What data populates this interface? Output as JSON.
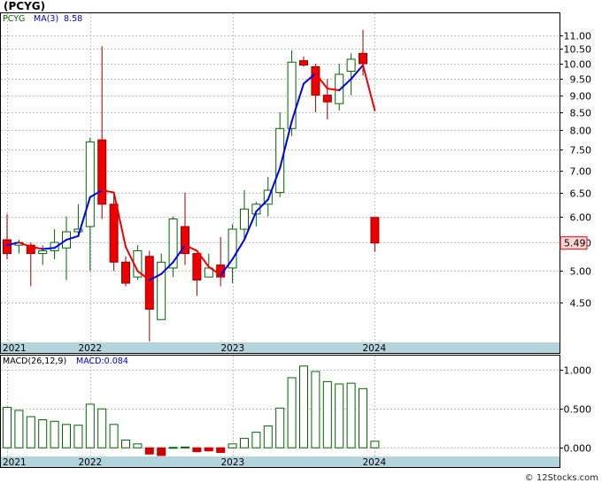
{
  "title": "(PCYG)",
  "watermark": "© 12Stocks.com",
  "price_panel": {
    "legend_symbol": "PCYG",
    "legend_ma_label": "MA(3)",
    "legend_ma_value": "8.58",
    "current_price_label": "5.49"
  },
  "macd_panel": {
    "legend_label": "MACD(26,12,9)",
    "legend_value_label": "MACD:0.084"
  },
  "colors": {
    "up_candle_fill": "#ffffff",
    "up_candle_border": "#006400",
    "down_candle_fill": "#ee0000",
    "down_candle_border": "#990000",
    "ma_up": "#0000ee",
    "ma_down": "#ee0000",
    "macd_pos": "#006400",
    "macd_neg": "#cc0000",
    "date_band": "#b3d4dc",
    "grid": "#c0c0c0"
  },
  "chart_data": [
    {
      "type": "candlestick",
      "scale": "log",
      "period": "monthly",
      "ylim": [
        3.95,
        11.8
      ],
      "y_ticks": [
        4.5,
        5.0,
        5.5,
        6.0,
        6.5,
        7.0,
        7.5,
        8.0,
        8.5,
        9.0,
        9.5,
        10.0,
        10.5,
        11.0
      ],
      "y_tick_labels": [
        "4.50",
        "5.00",
        "5.50",
        "6.00",
        "6.50",
        "7.00",
        "7.50",
        "8.00",
        "8.50",
        "9.00",
        "9.50",
        "10.00",
        "10.50",
        "11.00"
      ],
      "x_year_labels": [
        {
          "label": "2021",
          "index": 0
        },
        {
          "label": "2022",
          "index": 7
        },
        {
          "label": "2023",
          "index": 19
        },
        {
          "label": "2024",
          "index": 31
        }
      ],
      "candles": [
        {
          "open": 5.55,
          "high": 6.05,
          "low": 5.2,
          "close": 5.3
        },
        {
          "open": 5.45,
          "high": 5.55,
          "low": 5.3,
          "close": 5.5
        },
        {
          "open": 5.45,
          "high": 5.5,
          "low": 4.75,
          "close": 5.3
        },
        {
          "open": 5.3,
          "high": 5.45,
          "low": 5.1,
          "close": 5.35
        },
        {
          "open": 5.35,
          "high": 5.75,
          "low": 5.2,
          "close": 5.5
        },
        {
          "open": 5.4,
          "high": 6.0,
          "low": 4.85,
          "close": 5.7
        },
        {
          "open": 5.7,
          "high": 6.25,
          "low": 5.6,
          "close": 5.75
        },
        {
          "open": 5.8,
          "high": 7.8,
          "low": 5.0,
          "close": 7.7
        },
        {
          "open": 7.75,
          "high": 10.6,
          "low": 5.95,
          "close": 6.25
        },
        {
          "open": 6.25,
          "high": 6.45,
          "low": 5.0,
          "close": 5.15
        },
        {
          "open": 5.15,
          "high": 5.25,
          "low": 4.75,
          "close": 4.8
        },
        {
          "open": 4.9,
          "high": 5.45,
          "low": 4.85,
          "close": 5.35
        },
        {
          "open": 5.25,
          "high": 5.35,
          "low": 3.95,
          "close": 4.4
        },
        {
          "open": 4.25,
          "high": 5.3,
          "low": 4.25,
          "close": 5.15
        },
        {
          "open": 5.05,
          "high": 6.0,
          "low": 4.9,
          "close": 5.95
        },
        {
          "open": 5.8,
          "high": 6.5,
          "low": 5.1,
          "close": 5.3
        },
        {
          "open": 5.3,
          "high": 5.3,
          "low": 4.6,
          "close": 4.85
        },
        {
          "open": 4.9,
          "high": 5.3,
          "low": 4.9,
          "close": 5.05
        },
        {
          "open": 5.1,
          "high": 5.6,
          "low": 4.75,
          "close": 4.9
        },
        {
          "open": 5.05,
          "high": 5.85,
          "low": 4.8,
          "close": 5.75
        },
        {
          "open": 5.75,
          "high": 6.55,
          "low": 5.55,
          "close": 6.15
        },
        {
          "open": 6.05,
          "high": 6.3,
          "low": 5.8,
          "close": 6.25
        },
        {
          "open": 6.25,
          "high": 6.85,
          "low": 6.0,
          "close": 6.55
        },
        {
          "open": 6.5,
          "high": 8.5,
          "low": 6.4,
          "close": 8.05
        },
        {
          "open": 8.05,
          "high": 10.45,
          "low": 7.85,
          "close": 10.05
        },
        {
          "open": 10.1,
          "high": 10.25,
          "low": 9.9,
          "close": 9.95
        },
        {
          "open": 9.9,
          "high": 10.0,
          "low": 8.5,
          "close": 9.0
        },
        {
          "open": 9.0,
          "high": 9.5,
          "low": 8.3,
          "close": 8.8
        },
        {
          "open": 8.75,
          "high": 10.0,
          "low": 8.55,
          "close": 9.65
        },
        {
          "open": 9.75,
          "high": 10.35,
          "low": 9.0,
          "close": 10.15
        },
        {
          "open": 10.35,
          "high": 11.2,
          "low": 9.6,
          "close": 10.0
        },
        {
          "open": 5.98,
          "high": 5.98,
          "low": 5.33,
          "close": 5.49
        }
      ],
      "ma3": [
        5.45,
        5.5,
        5.42,
        5.38,
        5.4,
        5.55,
        5.62,
        6.4,
        6.55,
        6.5,
        5.42,
        5.0,
        4.85,
        4.95,
        5.15,
        5.45,
        5.35,
        5.07,
        4.93,
        5.2,
        5.55,
        6.1,
        6.35,
        7.05,
        8.25,
        9.35,
        9.68,
        9.2,
        9.15,
        9.5,
        9.95,
        8.55
      ]
    },
    {
      "type": "bar",
      "name": "MACD(26,12,9)",
      "ylim": [
        -0.1,
        1.15
      ],
      "y_ticks": [
        0.0,
        0.5,
        1.0
      ],
      "y_tick_labels": [
        "0.000",
        "0.500",
        "1.000"
      ],
      "x_year_labels": [
        {
          "label": "2021",
          "index": 0
        },
        {
          "label": "2022",
          "index": 7
        },
        {
          "label": "2023",
          "index": 19
        },
        {
          "label": "2024",
          "index": 31
        }
      ],
      "values": [
        0.52,
        0.48,
        0.4,
        0.36,
        0.34,
        0.3,
        0.29,
        0.56,
        0.5,
        0.3,
        0.1,
        0.05,
        -0.08,
        -0.1,
        0.005,
        0.01,
        -0.05,
        -0.04,
        -0.06,
        0.05,
        0.12,
        0.2,
        0.28,
        0.51,
        0.9,
        1.05,
        0.98,
        0.85,
        0.82,
        0.83,
        0.76,
        0.084
      ]
    }
  ]
}
